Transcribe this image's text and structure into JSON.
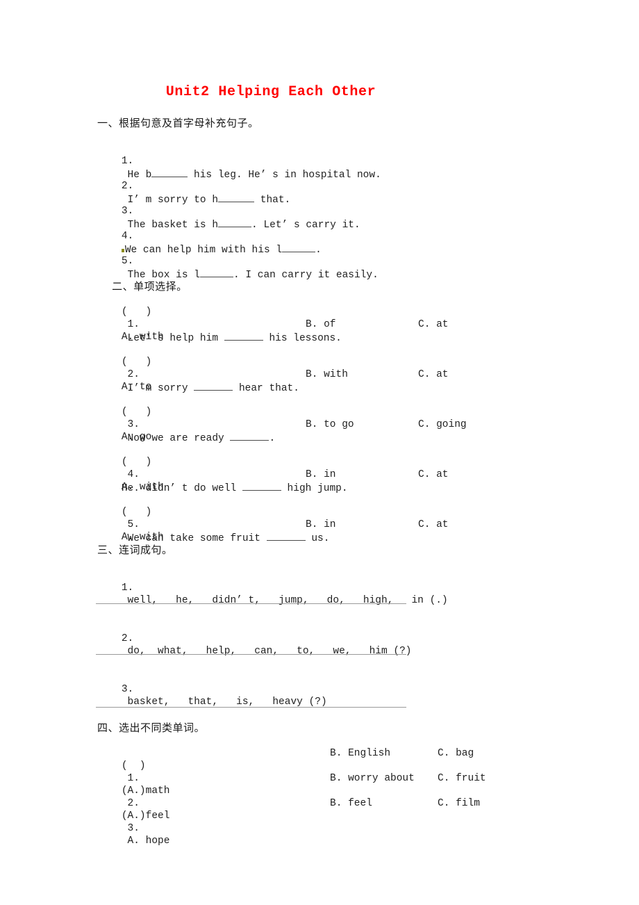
{
  "document": {
    "title": "Unit2 Helping Each Other",
    "title_color": "#ff0000",
    "body_color": "#1f1f1f",
    "rule_color": "#9a9a9a",
    "artifact_color": "#8c8c1e"
  },
  "section1": {
    "heading": "一、根据句意及首字母补充句子。",
    "items": [
      {
        "num": "1.",
        "before": "He b",
        "after": "his leg. He’ s in hospital now."
      },
      {
        "num": "2.",
        "before": "I’ m sorry to h",
        "after": "that."
      },
      {
        "num": "3.",
        "before": "The basket is h",
        "after": ". Let’ s carry it."
      },
      {
        "num": "4.",
        "before": "We can help him with his l",
        "after": "."
      },
      {
        "num": "5.",
        "before": "The box is l",
        "after": ". I can carry it easily."
      }
    ]
  },
  "section2": {
    "heading": "二、单项选择。",
    "questions": [
      {
        "bracket": "(   )",
        "num": "1.",
        "before": "Let’ s help him",
        "after": "his lessons.",
        "options": {
          "a": "A. with",
          "b": "B. of",
          "c": "C. at"
        }
      },
      {
        "bracket": "(   )",
        "num": "2.",
        "before": "I’ m sorry",
        "after": "hear that.",
        "options": {
          "a": "A. to",
          "b": "B. with",
          "c": "C. at"
        }
      },
      {
        "bracket": "(   )",
        "num": "3.",
        "before": "Now we are ready",
        "after": ".",
        "options": {
          "a": "A. go",
          "b": "B. to go",
          "c": "C. going"
        }
      },
      {
        "bracket": "(   )",
        "num": "4.",
        "before": "He. didn’ t do well",
        "after": "high jump.",
        "options": {
          "a": "A. with",
          "b": "B. in",
          "c": "C. at"
        }
      },
      {
        "bracket": "(   )",
        "num": "5.",
        "before": "We can take some fruit",
        "after": "us.",
        "options": {
          "a": "A. with",
          "b": "B. in",
          "c": "C. at"
        }
      }
    ]
  },
  "section3": {
    "heading": "三、连词成句。",
    "items": [
      {
        "num": "1.",
        "words": "well,   he,   didn’ t,   jump,   do,   high,   in (.)"
      },
      {
        "num": "2.",
        "words": "do,  what,   help,   can,   to,   we,   him (?)"
      },
      {
        "num": "3.",
        "words": "basket,   that,   is,   heavy (?)"
      }
    ]
  },
  "section4": {
    "heading": "四、选出不同类单词。",
    "questions": [
      {
        "bracket": "(  )",
        "num": "1.",
        "a": "A. math",
        "b": "B. English",
        "c": "C. bag"
      },
      {
        "bracket": "(  )",
        "num": "2.",
        "a": "A. feel",
        "b": "B. worry about",
        "c": "C. fruit"
      },
      {
        "bracket": "(  )",
        "num": "3.",
        "a": "A. hope",
        "b": "B. feel",
        "c": "C. film"
      }
    ]
  }
}
